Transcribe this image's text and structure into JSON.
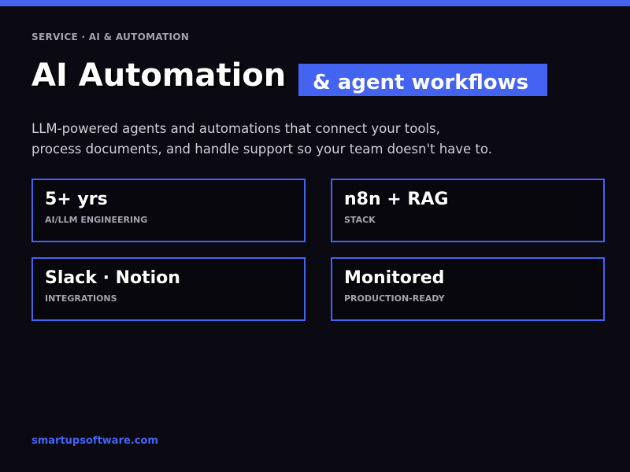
{
  "colors": {
    "accent": "#4463f0",
    "background": "#0b0a12",
    "muted_text": "#a3a3ad"
  },
  "header": {
    "eyebrow": "SERVICE · AI & AUTOMATION",
    "title": "AI Automation",
    "highlight": "& agent workflows"
  },
  "description": {
    "line1": "LLM-powered agents and automations that connect your tools,",
    "line2": "process documents, and handle support so your team doesn't have to."
  },
  "stats": [
    {
      "value": "5+ yrs",
      "label": "AI/LLM ENGINEERING"
    },
    {
      "value": "n8n + RAG",
      "label": "STACK"
    },
    {
      "value": "Slack · Notion",
      "label": "INTEGRATIONS"
    },
    {
      "value": "Monitored",
      "label": "PRODUCTION-READY"
    }
  ],
  "footer": {
    "link": "smartupsoftware.com"
  }
}
